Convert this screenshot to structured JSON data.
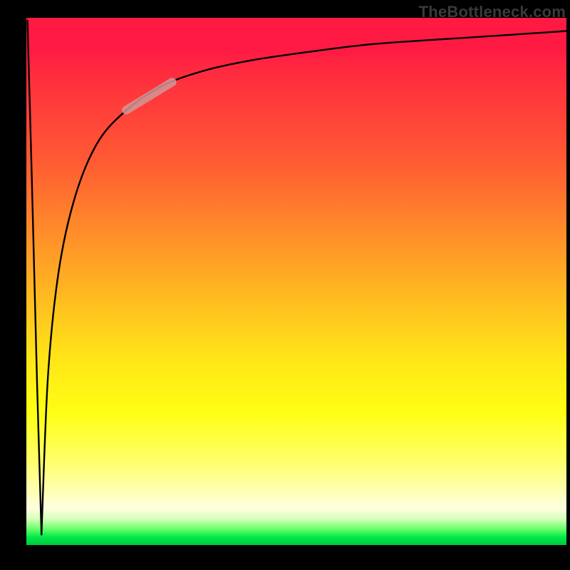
{
  "watermark": "TheBottleneck.com",
  "gradient_colors": {
    "top": "#ff1a44",
    "mid1": "#ff8a2a",
    "mid2": "#ffff14",
    "mid3": "#ffffe0",
    "bottom": "#00c83e"
  },
  "highlight_segment": {
    "color_rgba": "rgba(210,150,150,0.85)",
    "note": "short pale salmon stroke riding the curve around x≈0.19–0.27"
  },
  "chart_data": {
    "type": "line",
    "title": "",
    "xlabel": "",
    "ylabel": "",
    "xlim": [
      0,
      1
    ],
    "ylim": [
      0,
      1
    ],
    "axes_visible": false,
    "grid": false,
    "series": [
      {
        "name": "descending-near-vertical",
        "x": [
          0.002,
          0.01,
          0.02,
          0.028
        ],
        "y": [
          0.995,
          0.7,
          0.3,
          0.02
        ]
      },
      {
        "name": "ascending-log-like",
        "x": [
          0.028,
          0.04,
          0.06,
          0.09,
          0.13,
          0.18,
          0.25,
          0.33,
          0.42,
          0.52,
          0.64,
          0.78,
          0.9,
          1.0
        ],
        "y": [
          0.02,
          0.32,
          0.52,
          0.66,
          0.76,
          0.82,
          0.87,
          0.9,
          0.92,
          0.935,
          0.95,
          0.96,
          0.968,
          0.975
        ]
      },
      {
        "name": "highlight-stroke-on-curve",
        "x": [
          0.185,
          0.27
        ],
        "y": [
          0.825,
          0.878
        ]
      }
    ]
  }
}
